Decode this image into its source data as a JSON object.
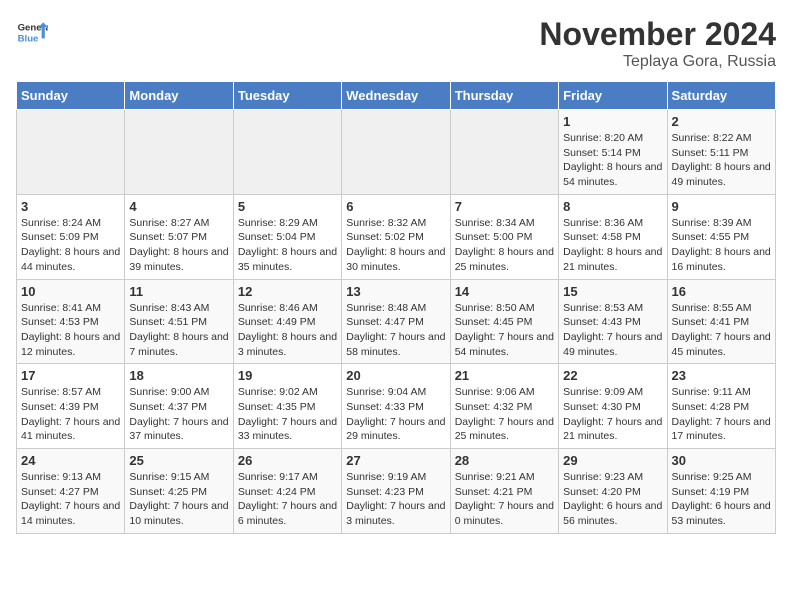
{
  "header": {
    "logo_general": "General",
    "logo_blue": "Blue",
    "title": "November 2024",
    "subtitle": "Teplaya Gora, Russia"
  },
  "weekdays": [
    "Sunday",
    "Monday",
    "Tuesday",
    "Wednesday",
    "Thursday",
    "Friday",
    "Saturday"
  ],
  "weeks": [
    [
      {
        "day": "",
        "content": ""
      },
      {
        "day": "",
        "content": ""
      },
      {
        "day": "",
        "content": ""
      },
      {
        "day": "",
        "content": ""
      },
      {
        "day": "",
        "content": ""
      },
      {
        "day": "1",
        "content": "Sunrise: 8:20 AM\nSunset: 5:14 PM\nDaylight: 8 hours and 54 minutes."
      },
      {
        "day": "2",
        "content": "Sunrise: 8:22 AM\nSunset: 5:11 PM\nDaylight: 8 hours and 49 minutes."
      }
    ],
    [
      {
        "day": "3",
        "content": "Sunrise: 8:24 AM\nSunset: 5:09 PM\nDaylight: 8 hours and 44 minutes."
      },
      {
        "day": "4",
        "content": "Sunrise: 8:27 AM\nSunset: 5:07 PM\nDaylight: 8 hours and 39 minutes."
      },
      {
        "day": "5",
        "content": "Sunrise: 8:29 AM\nSunset: 5:04 PM\nDaylight: 8 hours and 35 minutes."
      },
      {
        "day": "6",
        "content": "Sunrise: 8:32 AM\nSunset: 5:02 PM\nDaylight: 8 hours and 30 minutes."
      },
      {
        "day": "7",
        "content": "Sunrise: 8:34 AM\nSunset: 5:00 PM\nDaylight: 8 hours and 25 minutes."
      },
      {
        "day": "8",
        "content": "Sunrise: 8:36 AM\nSunset: 4:58 PM\nDaylight: 8 hours and 21 minutes."
      },
      {
        "day": "9",
        "content": "Sunrise: 8:39 AM\nSunset: 4:55 PM\nDaylight: 8 hours and 16 minutes."
      }
    ],
    [
      {
        "day": "10",
        "content": "Sunrise: 8:41 AM\nSunset: 4:53 PM\nDaylight: 8 hours and 12 minutes."
      },
      {
        "day": "11",
        "content": "Sunrise: 8:43 AM\nSunset: 4:51 PM\nDaylight: 8 hours and 7 minutes."
      },
      {
        "day": "12",
        "content": "Sunrise: 8:46 AM\nSunset: 4:49 PM\nDaylight: 8 hours and 3 minutes."
      },
      {
        "day": "13",
        "content": "Sunrise: 8:48 AM\nSunset: 4:47 PM\nDaylight: 7 hours and 58 minutes."
      },
      {
        "day": "14",
        "content": "Sunrise: 8:50 AM\nSunset: 4:45 PM\nDaylight: 7 hours and 54 minutes."
      },
      {
        "day": "15",
        "content": "Sunrise: 8:53 AM\nSunset: 4:43 PM\nDaylight: 7 hours and 49 minutes."
      },
      {
        "day": "16",
        "content": "Sunrise: 8:55 AM\nSunset: 4:41 PM\nDaylight: 7 hours and 45 minutes."
      }
    ],
    [
      {
        "day": "17",
        "content": "Sunrise: 8:57 AM\nSunset: 4:39 PM\nDaylight: 7 hours and 41 minutes."
      },
      {
        "day": "18",
        "content": "Sunrise: 9:00 AM\nSunset: 4:37 PM\nDaylight: 7 hours and 37 minutes."
      },
      {
        "day": "19",
        "content": "Sunrise: 9:02 AM\nSunset: 4:35 PM\nDaylight: 7 hours and 33 minutes."
      },
      {
        "day": "20",
        "content": "Sunrise: 9:04 AM\nSunset: 4:33 PM\nDaylight: 7 hours and 29 minutes."
      },
      {
        "day": "21",
        "content": "Sunrise: 9:06 AM\nSunset: 4:32 PM\nDaylight: 7 hours and 25 minutes."
      },
      {
        "day": "22",
        "content": "Sunrise: 9:09 AM\nSunset: 4:30 PM\nDaylight: 7 hours and 21 minutes."
      },
      {
        "day": "23",
        "content": "Sunrise: 9:11 AM\nSunset: 4:28 PM\nDaylight: 7 hours and 17 minutes."
      }
    ],
    [
      {
        "day": "24",
        "content": "Sunrise: 9:13 AM\nSunset: 4:27 PM\nDaylight: 7 hours and 14 minutes."
      },
      {
        "day": "25",
        "content": "Sunrise: 9:15 AM\nSunset: 4:25 PM\nDaylight: 7 hours and 10 minutes."
      },
      {
        "day": "26",
        "content": "Sunrise: 9:17 AM\nSunset: 4:24 PM\nDaylight: 7 hours and 6 minutes."
      },
      {
        "day": "27",
        "content": "Sunrise: 9:19 AM\nSunset: 4:23 PM\nDaylight: 7 hours and 3 minutes."
      },
      {
        "day": "28",
        "content": "Sunrise: 9:21 AM\nSunset: 4:21 PM\nDaylight: 7 hours and 0 minutes."
      },
      {
        "day": "29",
        "content": "Sunrise: 9:23 AM\nSunset: 4:20 PM\nDaylight: 6 hours and 56 minutes."
      },
      {
        "day": "30",
        "content": "Sunrise: 9:25 AM\nSunset: 4:19 PM\nDaylight: 6 hours and 53 minutes."
      }
    ]
  ]
}
